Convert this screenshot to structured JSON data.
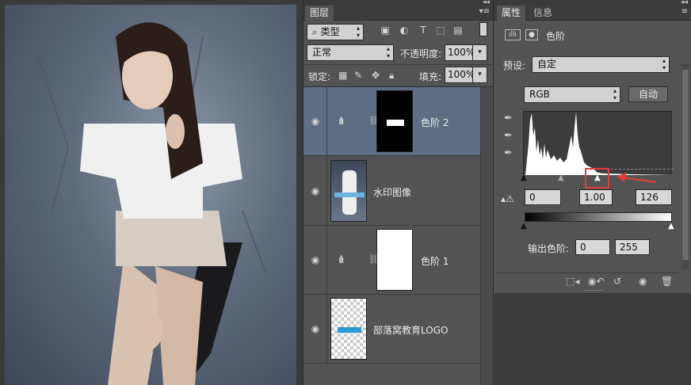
{
  "layers_panel": {
    "tab_label": "图层",
    "filter_kind": "类型",
    "blend_mode": "正常",
    "opacity_label": "不透明度:",
    "opacity_value": "100%",
    "lock_label": "锁定:",
    "fill_label": "填充:",
    "fill_value": "100%",
    "layers": [
      {
        "name": "色阶 2",
        "type": "adjustment",
        "selected": true
      },
      {
        "name": "水印图像",
        "type": "image",
        "selected": false
      },
      {
        "name": "色阶 1",
        "type": "adjustment",
        "selected": false
      },
      {
        "name": "部落窝教育LOGO",
        "type": "image",
        "selected": false
      }
    ]
  },
  "properties_panel": {
    "tab_properties": "属性",
    "tab_info": "信息",
    "adjustment_title": "色阶",
    "preset_label": "预设:",
    "preset_value": "自定",
    "channel_value": "RGB",
    "auto_button": "自动",
    "input_black": "0",
    "input_gamma": "1.00",
    "input_white": "126",
    "output_label": "输出色阶:",
    "output_black": "0",
    "output_white": "255"
  },
  "icons": {
    "search": "search-icon",
    "eye": "eye-icon",
    "link": "link-icon",
    "lock": "lock-icon",
    "eyedropper": "eyedropper-icon",
    "trash": "trash-icon"
  },
  "colors": {
    "selected_layer": "#5d6d83",
    "highlight_box": "#e23b3b",
    "arrow": "#e23b3b"
  }
}
